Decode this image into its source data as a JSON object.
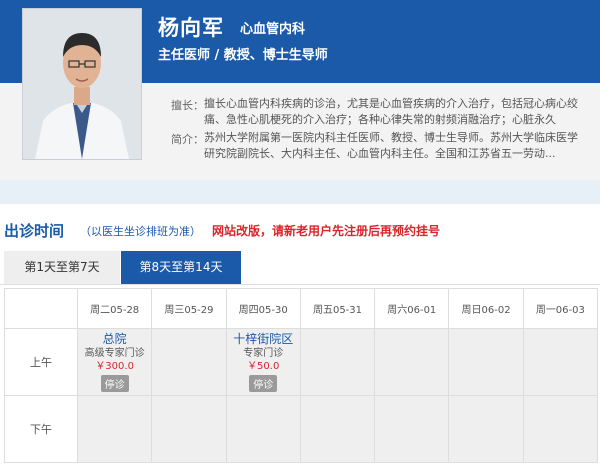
{
  "doctor": {
    "name": "杨向军",
    "department": "心血管内科",
    "title": "主任医师 / 教授、博士生导师",
    "specialty_label": "擅长：",
    "specialty_text": "擅长心血管内科疾病的诊治，尤其是心血管疾病的介入治疗，包括冠心病心绞痛、急性心肌梗死的介入治疗；各种心律失常的射频消融治疗；心脏永久",
    "intro_label": "简介：",
    "intro_text": "苏州大学附属第一医院内科主任医师、教授、博士生导师。苏州大学临床医学研究院副院长、大内科主任、心血管内科主任。全国和江苏省五一劳动..."
  },
  "schedule": {
    "heading": "出诊时间",
    "subheading": "（以医生坐诊排班为准）",
    "notice": "网站改版，请新老用户先注册后再预约挂号",
    "tabs": [
      "第1天至第7天",
      "第8天至第14天"
    ],
    "days": [
      "周二05-28",
      "周三05-29",
      "周四05-30",
      "周五05-31",
      "周六06-01",
      "周日06-02",
      "周一06-03"
    ],
    "rows": [
      "上午",
      "下午"
    ],
    "morning_slots": [
      {
        "location": "总院",
        "type": "高级专家门诊",
        "price": "￥300.0",
        "status": "停诊"
      },
      null,
      {
        "location": "十梓街院区",
        "type": "专家门诊",
        "price": "￥50.0",
        "status": "停诊"
      },
      null,
      null,
      null,
      null
    ]
  },
  "colors": {
    "brand": "#1a5aa8",
    "notice": "#d9262c"
  }
}
